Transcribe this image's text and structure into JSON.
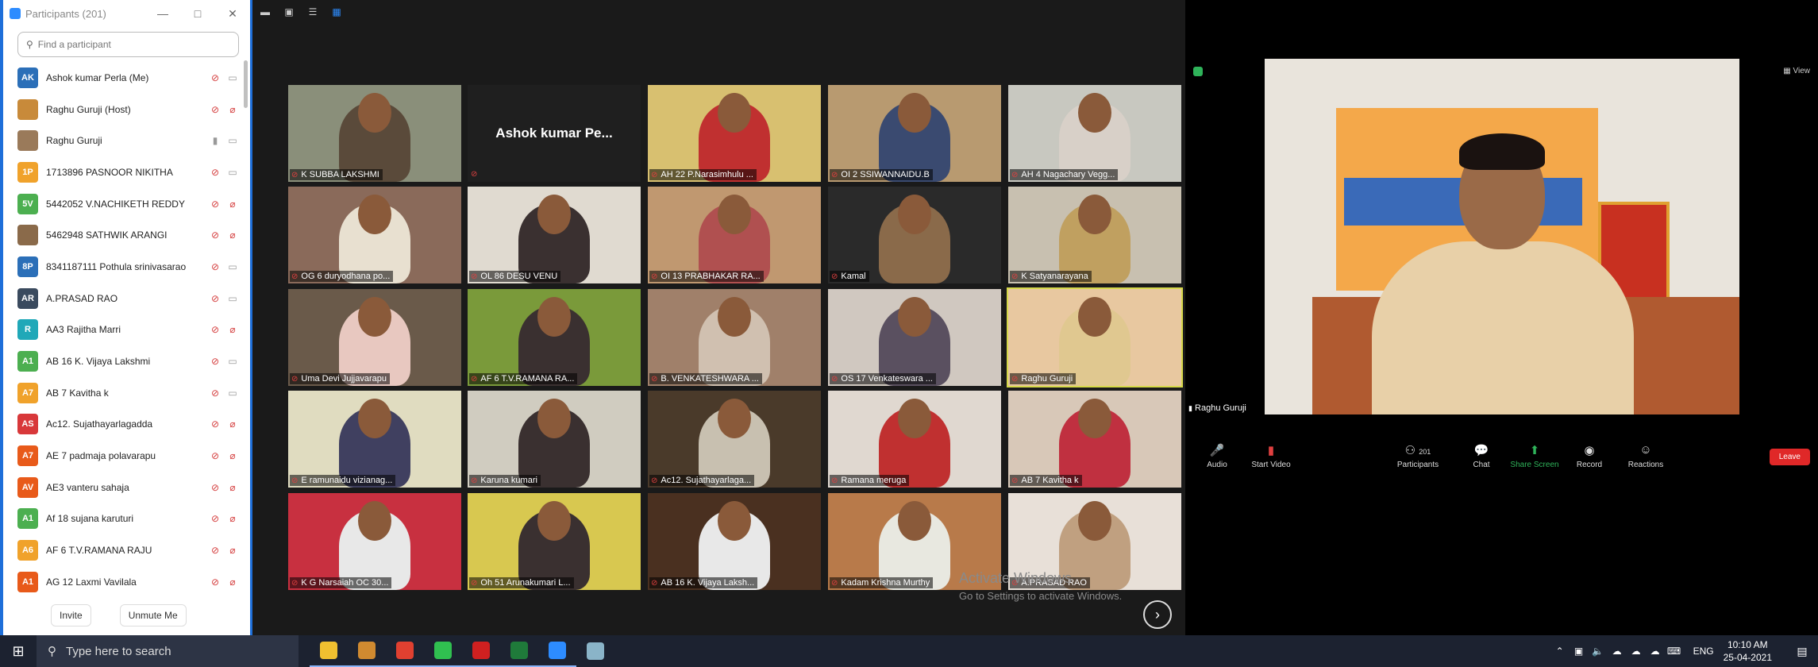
{
  "participants_panel": {
    "title": "Participants (201)",
    "search_placeholder": "Find a participant",
    "invite_label": "Invite",
    "unmute_label": "Unmute Me",
    "items": [
      {
        "initials": "AK",
        "name": "Ashok kumar Perla (Me)",
        "color": "#2b6fb8",
        "mic_muted": true,
        "video_off": false
      },
      {
        "initials": "",
        "name": "Raghu Guruji (Host)",
        "color": "#c88a3a",
        "mic_muted": true,
        "video_off": true
      },
      {
        "initials": "",
        "name": "Raghu Guruji",
        "color": "#9a7a5a",
        "mic_muted": false,
        "video_off": false
      },
      {
        "initials": "1P",
        "name": "1713896 PASNOOR NIKITHA",
        "color": "#f0a22b",
        "mic_muted": true,
        "video_off": false
      },
      {
        "initials": "5V",
        "name": "5442052 V.NACHIKETH REDDY",
        "color": "#4caf50",
        "mic_muted": true,
        "video_off": true
      },
      {
        "initials": "",
        "name": "5462948 SATHWIK ARANGI",
        "color": "#8a6a4a",
        "mic_muted": true,
        "video_off": true
      },
      {
        "initials": "8P",
        "name": "8341187111 Pothula srinivasarao",
        "color": "#2b6fb8",
        "mic_muted": true,
        "video_off": false
      },
      {
        "initials": "AR",
        "name": "A.PRASAD RAO",
        "color": "#3a4a5e",
        "mic_muted": true,
        "video_off": false
      },
      {
        "initials": "R",
        "name": "AA3 Rajitha Marri",
        "color": "#20a8b8",
        "mic_muted": true,
        "video_off": true
      },
      {
        "initials": "A1",
        "name": "AB 16 K. Vijaya Lakshmi",
        "color": "#4caf50",
        "mic_muted": true,
        "video_off": false
      },
      {
        "initials": "A7",
        "name": "AB 7 Kavitha k",
        "color": "#f0a22b",
        "mic_muted": true,
        "video_off": false
      },
      {
        "initials": "AS",
        "name": "Ac12.  Sujathayarlagadda",
        "color": "#d8383a",
        "mic_muted": true,
        "video_off": true
      },
      {
        "initials": "A7",
        "name": "AE 7 padmaja polavarapu",
        "color": "#e85a1a",
        "mic_muted": true,
        "video_off": true
      },
      {
        "initials": "AV",
        "name": "AE3 vanteru  sahaja",
        "color": "#e85a1a",
        "mic_muted": true,
        "video_off": true
      },
      {
        "initials": "A1",
        "name": "Af 18 sujana karuturi",
        "color": "#4caf50",
        "mic_muted": true,
        "video_off": true
      },
      {
        "initials": "A6",
        "name": "AF 6 T.V.RAMANA RAJU",
        "color": "#f0a22b",
        "mic_muted": true,
        "video_off": true
      },
      {
        "initials": "A1",
        "name": "AG 12 Laxmi Vavilala",
        "color": "#e85a1a",
        "mic_muted": true,
        "video_off": true
      }
    ]
  },
  "gallery": {
    "featured_name": "Ashok kumar Pe...",
    "tiles": [
      {
        "label": "K SUBBA LAKSHMI",
        "bg": "#8a8f7a",
        "fg": "#5a4a3a"
      },
      {
        "label": "",
        "bg": "#1f1f1f",
        "fg": "",
        "featured": true
      },
      {
        "label": "AH 22 P.Narasimhulu ...",
        "bg": "#d8c070",
        "fg": "#c03030"
      },
      {
        "label": "OI 2 SSIWANNAIDU.B",
        "bg": "#b89a70",
        "fg": "#3a4a70"
      },
      {
        "label": "AH 4 Nagachary Vegg...",
        "bg": "#c8c8c0",
        "fg": "#d8d0c8"
      },
      {
        "label": "OG 6 duryodhana po...",
        "bg": "#8a6a5a",
        "fg": "#e8e0d0"
      },
      {
        "label": "OL 86 DESU VENU",
        "bg": "#e0dad0",
        "fg": "#3a3030"
      },
      {
        "label": "OI 13 PRABHAKAR RA...",
        "bg": "#c09870",
        "fg": "#b05050"
      },
      {
        "label": "Kamal",
        "bg": "#2a2a2a",
        "fg": "#8a6a4a"
      },
      {
        "label": "K Satyanarayana",
        "bg": "#c8c0b0",
        "fg": "#c0a060"
      },
      {
        "label": "Uma Devi Jujjavarapu",
        "bg": "#6a5a4a",
        "fg": "#e8c8c0"
      },
      {
        "label": "AF 6 T.V.RAMANA RA...",
        "bg": "#7a9a3a",
        "fg": "#3a3030"
      },
      {
        "label": "B. VENKATESHWARA ...",
        "bg": "#a0806a",
        "fg": "#d0c0b0"
      },
      {
        "label": "OS 17 Venkateswara ...",
        "bg": "#d0c8c0",
        "fg": "#5a5060"
      },
      {
        "label": "Raghu Guruji",
        "bg": "#e8c8a0",
        "fg": "#e0c890",
        "active": true
      },
      {
        "label": "E ramunaidu  vizianag...",
        "bg": "#e0dcc0",
        "fg": "#404060"
      },
      {
        "label": "Karuna kumari",
        "bg": "#d0ccc0",
        "fg": "#3a3030"
      },
      {
        "label": "Ac12.  Sujathayarlaga...",
        "bg": "#4a3a2a",
        "fg": "#c8c0b0"
      },
      {
        "label": "Ramana meruga",
        "bg": "#e0d8d0",
        "fg": "#c03030"
      },
      {
        "label": "AB 7 Kavitha k",
        "bg": "#d8c8b8",
        "fg": "#c03040"
      },
      {
        "label": "K G Narsaiah  OC 30...",
        "bg": "#c83040",
        "fg": "#e8e8e8"
      },
      {
        "label": "Oh  51 Arunakumari L...",
        "bg": "#d8c850",
        "fg": "#3a3030"
      },
      {
        "label": "AB 16 K. Vijaya Laksh...",
        "bg": "#4a3020",
        "fg": "#e8e8e8"
      },
      {
        "label": "Kadam Krishna Murthy",
        "bg": "#b87a4a",
        "fg": "#e8e8e0"
      },
      {
        "label": "A.PRASAD RAO",
        "bg": "#e8e0d8",
        "fg": "#c0a080"
      }
    ],
    "watermark_title": "Activate Windows",
    "watermark_sub": "Go to Settings to activate Windows."
  },
  "speaker": {
    "name": "Raghu Guruji",
    "view_label": "View",
    "toolbar": {
      "audio": "Audio",
      "start_video": "Start Video",
      "participants": "Participants",
      "participants_count": "201",
      "chat": "Chat",
      "share_screen": "Share Screen",
      "record": "Record",
      "reactions": "Reactions",
      "leave": "Leave"
    }
  },
  "taskbar": {
    "search_placeholder": "Type here to search",
    "language": "ENG",
    "time": "10:10 AM",
    "date": "25-04-2021",
    "apps": [
      {
        "name": "file-explorer",
        "color": "#f0c030"
      },
      {
        "name": "media-player",
        "color": "#d08a30"
      },
      {
        "name": "chrome",
        "color": "#e04030"
      },
      {
        "name": "whatsapp",
        "color": "#30c050"
      },
      {
        "name": "opera",
        "color": "#d02020"
      },
      {
        "name": "excel",
        "color": "#1f7a3a"
      },
      {
        "name": "zoom",
        "color": "#2d8cff"
      },
      {
        "name": "browser",
        "color": "#8ab4c8"
      }
    ]
  }
}
